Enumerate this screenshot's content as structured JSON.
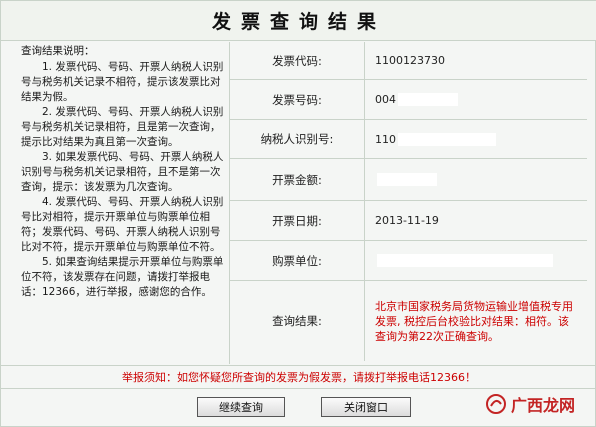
{
  "header": {
    "title": "发票查询结果"
  },
  "notes": {
    "heading": "查询结果说明：",
    "items": [
      "1. 发票代码、号码、开票人纳税人识别号与税务机关记录不相符，提示该发票比对结果为假。",
      "2. 发票代码、号码、开票人纳税人识别号与税务机关记录相符，且是第一次查询，提示比对结果为真且第一次查询。",
      "3. 如果发票代码、号码、开票人纳税人识别号与税务机关记录相符，且不是第一次查询，提示：该发票为几次查询。",
      "4. 发票代码、号码、开票人纳税人识别号比对相符，提示开票单位与购票单位相符；发票代码、号码、开票人纳税人识别号比对不符，提示开票单位与购票单位不符。",
      "5. 如果查询结果提示开票单位与购票单位不符，该发票存在问题，请拨打举报电话：12366，进行举报，感谢您的合作。"
    ]
  },
  "fields": {
    "code_label": "发票代码:",
    "code_value": "1100123730",
    "number_label": "发票号码:",
    "number_value": "004",
    "taxid_label": "纳税人识别号:",
    "taxid_value": "110",
    "amount_label": "开票金额:",
    "date_label": "开票日期:",
    "date_value": "2013-11-19",
    "buyer_label": "购票单位:",
    "result_label": "查询结果:",
    "result_value": "北京市国家税务局货物运输业增值税专用发票, 税控后台校验比对结果：相符。该查询为第22次正确查询。"
  },
  "hotline": "举报须知：如您怀疑您所查询的发票为假发票，请拨打举报电话12366！",
  "buttons": {
    "continue": "继续查询",
    "close": "关闭窗口"
  },
  "watermark": {
    "text": "广西龙网"
  },
  "colors": {
    "alert": "#cc0000",
    "border": "#c9d3c9"
  }
}
